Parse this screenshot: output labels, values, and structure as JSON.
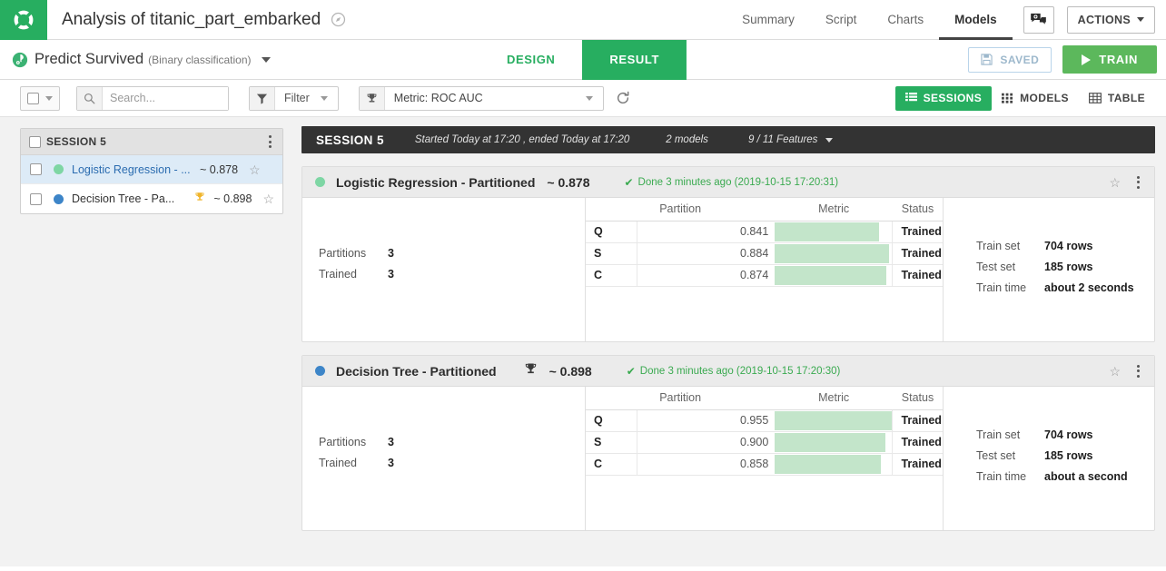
{
  "header": {
    "logo_icon": "lifebuoy-logo-icon",
    "project_title": "Analysis of titanic_part_embarked",
    "compass_icon": "compass-icon",
    "nav": [
      {
        "label": "Summary",
        "active": false
      },
      {
        "label": "Script",
        "active": false
      },
      {
        "label": "Charts",
        "active": false
      },
      {
        "label": "Models",
        "active": true
      }
    ],
    "chat_icon": "chat-bubble-plus-icon",
    "actions_label": "ACTIONS",
    "actions_caret_icon": "caret-down-icon"
  },
  "subheader": {
    "predict_icon": "target-prediction-icon",
    "predict_title": "Predict Survived",
    "predict_subtitle": "(Binary classification)",
    "predict_caret_icon": "caret-down-icon",
    "tab_design": "DESIGN",
    "tab_result": "RESULT",
    "active_tab": "RESULT",
    "saved_label": "SAVED",
    "saved_icon": "floppy-disk-icon",
    "train_label": "TRAIN",
    "train_icon": "play-triangle-icon"
  },
  "toolbar": {
    "select_all_checkbox_icon": "checkbox-icon",
    "select_all_caret_icon": "caret-down-icon",
    "search_icon": "search-icon",
    "search_value": "",
    "search_placeholder": "Search...",
    "filter_icon": "funnel-filter-icon",
    "filter_label": "Filter",
    "filter_caret_icon": "caret-down-icon",
    "metric_icon": "trophy-icon",
    "metric_label": "Metric: ROC AUC",
    "metric_caret_icon": "caret-down-icon",
    "refresh_icon": "refresh-icon",
    "views": [
      {
        "label": "SESSIONS",
        "icon": "list-view-icon",
        "active": true
      },
      {
        "label": "MODELS",
        "icon": "grid-view-icon",
        "active": false
      },
      {
        "label": "TABLE",
        "icon": "table-view-icon",
        "active": false
      }
    ]
  },
  "sidebar": {
    "session_label": "SESSION 5",
    "session_checkbox_icon": "checkbox-icon",
    "session_menu_icon": "kebab-menu-icon",
    "models": [
      {
        "name": "Logistic Regression - ...",
        "score": "~ 0.878",
        "color": "#7ed6a4",
        "selected": true,
        "trophy": false,
        "star_icon": "star-outline-icon"
      },
      {
        "name": "Decision Tree - Pa...",
        "score": "~ 0.898",
        "color": "#3d85c8",
        "selected": false,
        "trophy": true,
        "star_icon": "star-outline-icon"
      }
    ]
  },
  "session_bar": {
    "title": "SESSION 5",
    "meta": "Started Today at 17:20 , ended Today at 17:20",
    "models_count": "2 models",
    "features": "9 / 11 Features",
    "features_caret_icon": "caret-down-icon"
  },
  "cards": [
    {
      "dot_color": "#7ed6a4",
      "title": "Logistic Regression - Partitioned",
      "has_trophy": false,
      "trophy_icon": "trophy-icon",
      "score": "~ 0.878",
      "status_check_icon": "check-mark-icon",
      "status": "Done 3 minutes ago (2019-10-15 17:20:31)",
      "star_icon": "star-outline-icon",
      "menu_icon": "kebab-menu-icon",
      "left_stats": [
        {
          "label": "Partitions",
          "value": "3"
        },
        {
          "label": "Trained",
          "value": "3"
        }
      ],
      "table": {
        "headers": [
          "Partition",
          "Metric",
          "Status"
        ],
        "rows": [
          {
            "partition": "Q",
            "metric": "0.841",
            "bar_pct": 84.1,
            "status": "Trained"
          },
          {
            "partition": "S",
            "metric": "0.884",
            "bar_pct": 88.4,
            "status": "Trained"
          },
          {
            "partition": "C",
            "metric": "0.874",
            "bar_pct": 87.4,
            "status": "Trained"
          }
        ]
      },
      "right_stats": [
        {
          "label": "Train set",
          "value": "704 rows"
        },
        {
          "label": "Test set",
          "value": "185 rows"
        },
        {
          "label": "Train time",
          "value": "about 2 seconds"
        }
      ]
    },
    {
      "dot_color": "#3d85c8",
      "title": "Decision Tree - Partitioned",
      "has_trophy": true,
      "trophy_icon": "trophy-icon",
      "score": "~ 0.898",
      "status_check_icon": "check-mark-icon",
      "status": "Done 3 minutes ago (2019-10-15 17:20:30)",
      "star_icon": "star-outline-icon",
      "menu_icon": "kebab-menu-icon",
      "left_stats": [
        {
          "label": "Partitions",
          "value": "3"
        },
        {
          "label": "Trained",
          "value": "3"
        }
      ],
      "table": {
        "headers": [
          "Partition",
          "Metric",
          "Status"
        ],
        "rows": [
          {
            "partition": "Q",
            "metric": "0.955",
            "bar_pct": 95.5,
            "status": "Trained"
          },
          {
            "partition": "S",
            "metric": "0.900",
            "bar_pct": 90.0,
            "status": "Trained"
          },
          {
            "partition": "C",
            "metric": "0.858",
            "bar_pct": 85.8,
            "status": "Trained"
          }
        ]
      },
      "right_stats": [
        {
          "label": "Train set",
          "value": "704 rows"
        },
        {
          "label": "Test set",
          "value": "185 rows"
        },
        {
          "label": "Train time",
          "value": "about a second"
        }
      ]
    }
  ],
  "colors": {
    "brand_green": "#27ae60",
    "train_green": "#5cb85c",
    "status_green": "#3aaa50",
    "bar_green": "#c3e5ca",
    "dark_bar": "#333333",
    "selected_row": "#ddebf7",
    "link_blue": "#2b6cb0"
  }
}
